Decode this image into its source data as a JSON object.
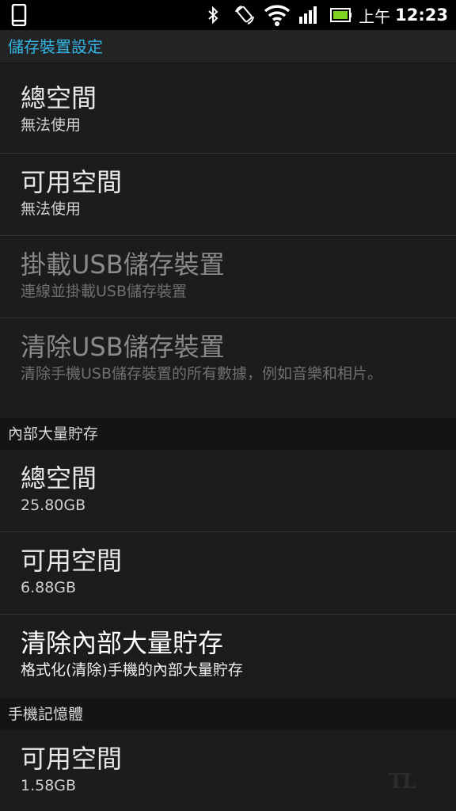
{
  "status_bar": {
    "icons": [
      "phone-icon",
      "bluetooth-icon",
      "rotate-icon",
      "wifi-icon",
      "signal-icon",
      "battery-icon"
    ],
    "ampm": "上午",
    "time": "12:23"
  },
  "title": "儲存裝置設定",
  "sd_section": {
    "items": [
      {
        "label": "總空間",
        "value": "無法使用"
      },
      {
        "label": "可用空間",
        "value": "無法使用"
      },
      {
        "label": "掛載USB儲存裝置",
        "value": "連線並掛載USB儲存裝置"
      },
      {
        "label": "清除USB儲存裝置",
        "value": "清除手機USB儲存裝置的所有數據，例如音樂和相片。"
      }
    ]
  },
  "internal_section": {
    "header": "內部大量貯存",
    "items": [
      {
        "label": "總空間",
        "value": "25.80GB"
      },
      {
        "label": "可用空間",
        "value": "6.88GB"
      },
      {
        "label": "清除內部大量貯存",
        "value": "格式化(清除)手機的內部大量貯存"
      }
    ]
  },
  "phone_memory_section": {
    "header": "手機記憶體",
    "items": [
      {
        "label": "可用空間",
        "value": "1.58GB"
      }
    ]
  },
  "colors": {
    "accent": "#33b5e5",
    "background": "#1c1c1c",
    "status_bar": "#000000",
    "battery_green": "#7ed321"
  }
}
